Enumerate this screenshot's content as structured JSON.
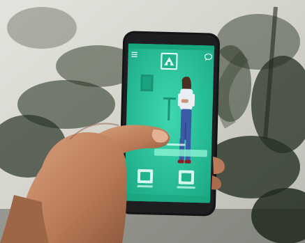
{
  "scene": {
    "description_kind": "photo",
    "colors": {
      "wall": "#d8d8d2",
      "plant_dark": "#1f2a1c",
      "phone_body": "#1b1b1d",
      "screen_teal": "#29c9a0",
      "screen_teal_dark": "#15876c",
      "highlight_bar": "#86f0d0",
      "skin": "#c98f6a"
    }
  },
  "phone": {
    "app": {
      "logo_icon": "house-logo-icon",
      "left_button_icon": "square-button-icon",
      "right_button_icon": "square-button-icon",
      "menu_icon": "menu-icon",
      "chat_icon": "chat-bubble-icon"
    }
  }
}
